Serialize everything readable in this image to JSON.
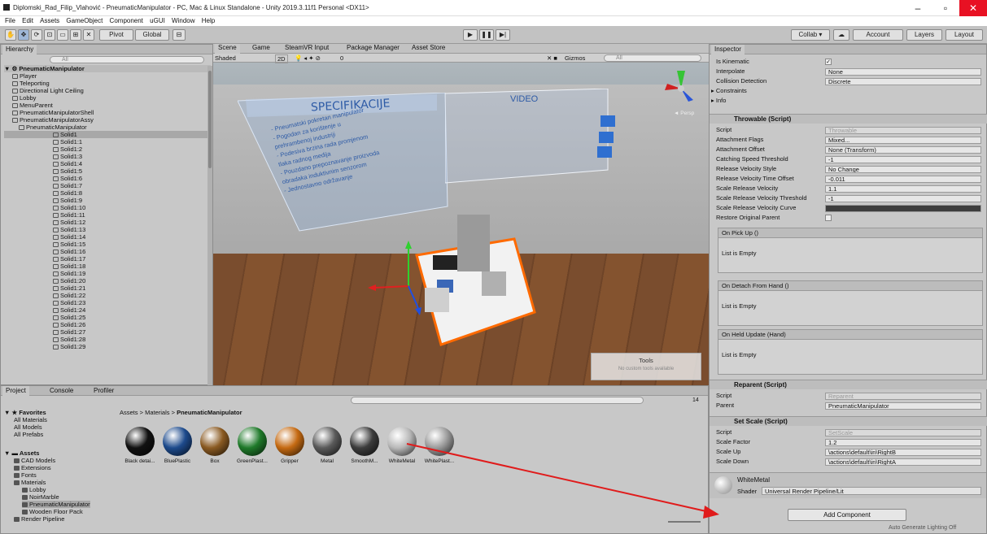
{
  "window": {
    "title": "Diplomski_Rad_Filip_Vlahović - PneumaticManipulator - PC, Mac & Linux Standalone - Unity 2019.3.11f1 Personal <DX11>",
    "minimize": "–",
    "maximize": "▫",
    "close": "✕"
  },
  "menu": [
    "File",
    "Edit",
    "Assets",
    "GameObject",
    "Component",
    "uGUI",
    "Window",
    "Help"
  ],
  "toolbar": {
    "pivot": "Pivot",
    "global": "Global",
    "collab": "Collab ▾",
    "account": "Account",
    "layers": "Layers",
    "layout": "Layout"
  },
  "hierarchy": {
    "tab": "Hierarchy",
    "search_placeholder": "All",
    "root": "PneumaticManipulator",
    "items": [
      "Player",
      "Teleporting",
      "Directional Light Ceiling",
      "Lobby",
      "MenuParent",
      "PneumaticManipulatorShell",
      "PneumaticManipulatorAssy",
      "PneumaticManipulator",
      "Solid1",
      "Solid1:1",
      "Solid1:2",
      "Solid1:3",
      "Solid1:4",
      "Solid1:5",
      "Solid1:6",
      "Solid1:7",
      "Solid1:8",
      "Solid1:9",
      "Solid1:10",
      "Solid1:11",
      "Solid1:12",
      "Solid1:13",
      "Solid1:14",
      "Solid1:15",
      "Solid1:16",
      "Solid1:17",
      "Solid1:18",
      "Solid1:19",
      "Solid1:20",
      "Solid1:21",
      "Solid1:22",
      "Solid1:23",
      "Solid1:24",
      "Solid1:25",
      "Solid1:26",
      "Solid1:27",
      "Solid1:28",
      "Solid1:29"
    ]
  },
  "scene_tabs": [
    "Scene",
    "Game",
    "SteamVR Input",
    "Package Manager",
    "Asset Store"
  ],
  "scene_toolbar": {
    "shading": "Shaded",
    "mode": "2D",
    "gizmos": "Gizmos",
    "search": "All",
    "fx_count": "0"
  },
  "scene": {
    "panel_left_title": "SPECIFIKACIJE",
    "panel_right_title": "VIDEO",
    "spec_lines": [
      "- Pneumatski pokretan manipulator",
      "- Pogodan za korištenje u",
      "prehrambenoj industriji",
      "- Podesiva brzina rada promjenom",
      "tlaka radnog medija",
      "- Pouzdano prepoznavanje proizvoda",
      "obradaka induktivnim senzorom",
      "- Jednostavno održavanje"
    ],
    "persp": "◄ Persp",
    "tools_title": "Tools",
    "tools_sub": "No custom tools available"
  },
  "inspector": {
    "tab": "Inspector",
    "top_rows": [
      {
        "label": "Is Kinematic",
        "value": "✓"
      },
      {
        "label": "Interpolate",
        "value": "None"
      },
      {
        "label": "Collision Detection",
        "value": "Discrete"
      }
    ],
    "foldouts": [
      "Constraints",
      "Info"
    ],
    "throwable": {
      "title": "Throwable (Script)",
      "rows": [
        {
          "label": "Script",
          "value": "Throwable"
        },
        {
          "label": "Attachment Flags",
          "value": "Mixed..."
        },
        {
          "label": "Attachment Offset",
          "value": "None (Transform)"
        },
        {
          "label": "Catching Speed Threshold",
          "value": "-1"
        },
        {
          "label": "Release Velocity Style",
          "value": "No Change"
        },
        {
          "label": "Release Velocity Time Offset",
          "value": "-0.011"
        },
        {
          "label": "Scale Release Velocity",
          "value": "1.1"
        },
        {
          "label": "Scale Release Velocity Threshold",
          "value": "-1"
        },
        {
          "label": "Scale Release Velocity Curve",
          "value": ""
        },
        {
          "label": "Restore Original Parent",
          "value": ""
        }
      ],
      "events": [
        {
          "title": "On Pick Up ()",
          "body": "List is Empty"
        },
        {
          "title": "On Detach From Hand ()",
          "body": "List is Empty"
        },
        {
          "title": "On Held Update (Hand)",
          "body": "List is Empty"
        }
      ]
    },
    "reparent": {
      "title": "Reparent (Script)",
      "rows": [
        {
          "label": "Script",
          "value": "Reparent"
        },
        {
          "label": "Parent",
          "value": "PneumaticManipulator"
        }
      ]
    },
    "setscale": {
      "title": "Set Scale (Script)",
      "rows": [
        {
          "label": "Script",
          "value": "SetScale"
        },
        {
          "label": "Scale Factor",
          "value": "1.2"
        },
        {
          "label": "Scale Up",
          "value": "\\actions\\default\\in\\RightB"
        },
        {
          "label": "Scale Down",
          "value": "\\actions\\default\\in\\RightA"
        }
      ]
    },
    "material": {
      "name": "WhiteMetal",
      "shader_label": "Shader",
      "shader": "Universal Render Pipeline/Lit"
    },
    "add_component": "Add Component",
    "status": "Auto Generate Lighting Off"
  },
  "project": {
    "tabs": [
      "Project",
      "Console",
      "Profiler"
    ],
    "favorites": "Favorites",
    "fav_items": [
      "All Materials",
      "All Models",
      "All Prefabs"
    ],
    "assets_root": "Assets",
    "tree": [
      "CAD Models",
      "Extensions",
      "Fonts",
      "Materials",
      "Lobby",
      "NoirMarble",
      "PneumaticManipulator",
      "Wooden Floor Pack",
      "Render Pipeline"
    ],
    "breadcrumb": [
      "Assets",
      "Materials",
      "PneumaticManipulator"
    ],
    "count": "14",
    "materials": [
      {
        "name": "Black detai...",
        "color": "#111111"
      },
      {
        "name": "BluePlastic",
        "color": "#1d4a8c"
      },
      {
        "name": "Box",
        "color": "#8a5a22"
      },
      {
        "name": "GreenPlast...",
        "color": "#1f7a2a"
      },
      {
        "name": "Gripper",
        "color": "#c56a12"
      },
      {
        "name": "Metal",
        "color": "#5a5a5a"
      },
      {
        "name": "SmoothM...",
        "color": "#3c3c3c"
      },
      {
        "name": "WhiteMetal",
        "color": "#b8b8b8"
      },
      {
        "name": "WhitePlast...",
        "color": "#9a9a9a"
      }
    ]
  },
  "colors": {
    "accent": "#3a72c4",
    "arrow": "#e01b1b",
    "selection": "#a8a8a8"
  }
}
